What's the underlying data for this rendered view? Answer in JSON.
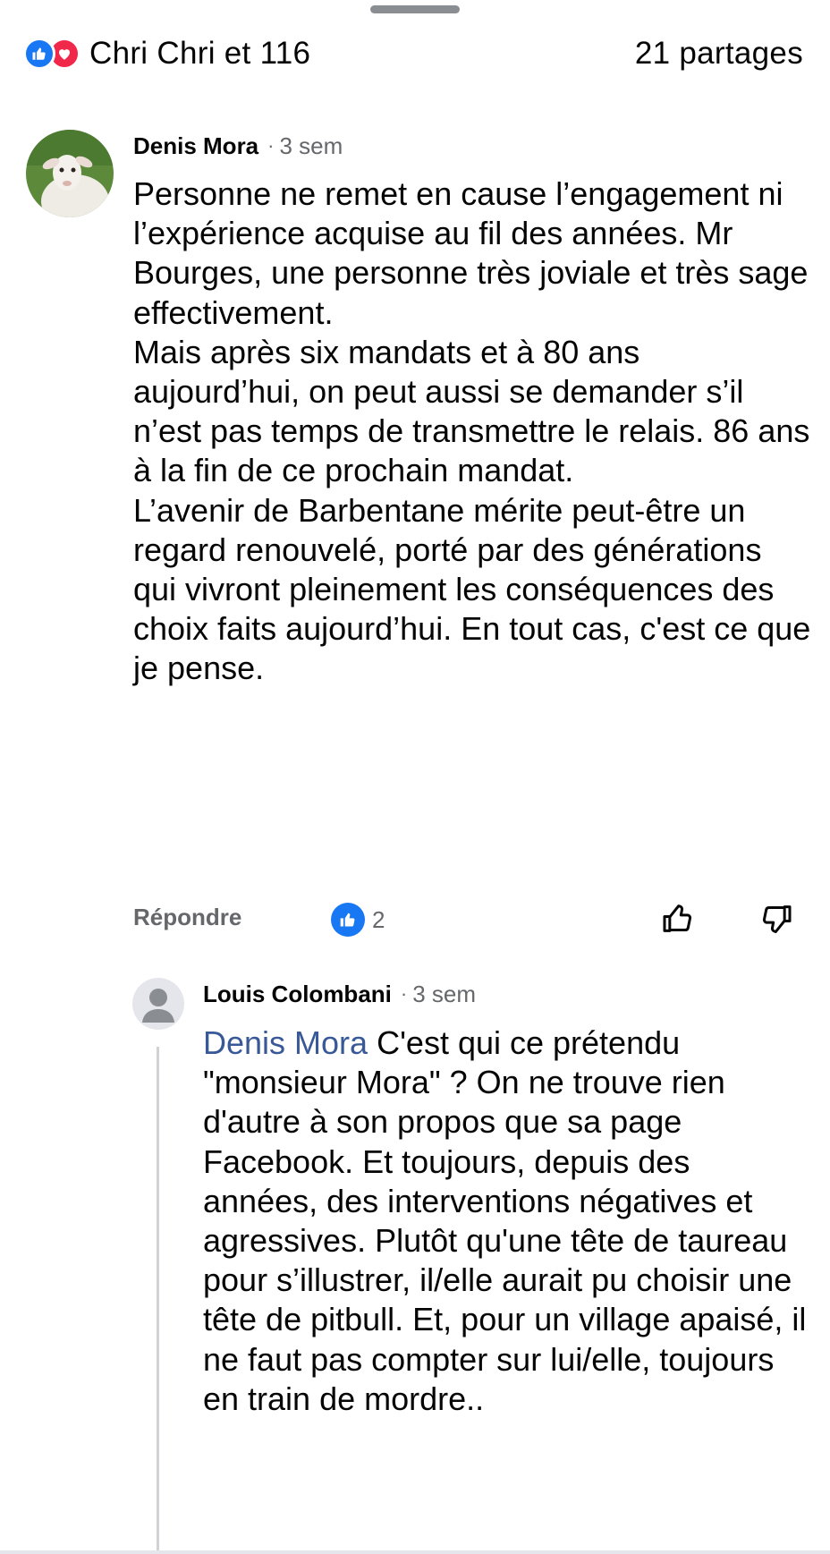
{
  "summary": {
    "reactions_text": "Chri Chri et 116",
    "shares_text": "21 partages",
    "reaction_icons": [
      "like-icon",
      "love-icon"
    ],
    "like_color": "#1877f2",
    "love_color": "#f0284a"
  },
  "comments": [
    {
      "author": "Denis Mora",
      "separator": "·",
      "time": "3 sem",
      "avatar": "lamb-photo",
      "paragraphs": [
        "Personne ne remet en cause l’engagement ni l’expérience acquise au fil des années. Mr Bourges, une personne très joviale et très sage effectivement.",
        "Mais après six mandats et à 80 ans aujourd’hui, on peut aussi se demander s’il n’est pas temps de transmettre le relais. 86 ans à la fin de ce prochain mandat.",
        "L’avenir de Barbentane mérite peut-être un regard renouvelé, porté par des générations qui vivront pleinement les conséquences des choix faits aujourd’hui. En tout cas, c'est ce que je pense."
      ],
      "reply_label": "Répondre",
      "like_count": "2"
    },
    {
      "author": "Louis Colombani",
      "separator": "·",
      "time": "3 sem",
      "avatar": "default-user-avatar",
      "mention": "Denis Mora",
      "text": " C'est qui ce prétendu \"monsieur Mora\" ? On ne trouve rien d'autre à son propos que sa page Facebook. Et toujours, depuis des années, des interventions négatives et agressives. Plutôt qu'une tête de taureau pour s’illustrer, il/elle aurait pu choisir une tête de pitbull. Et, pour un village apaisé, il ne faut pas compter sur lui/elle, toujours en train de mordre.."
    }
  ],
  "colors": {
    "accent": "#1877f2",
    "mention": "#385898",
    "secondary_text": "#65676b"
  }
}
